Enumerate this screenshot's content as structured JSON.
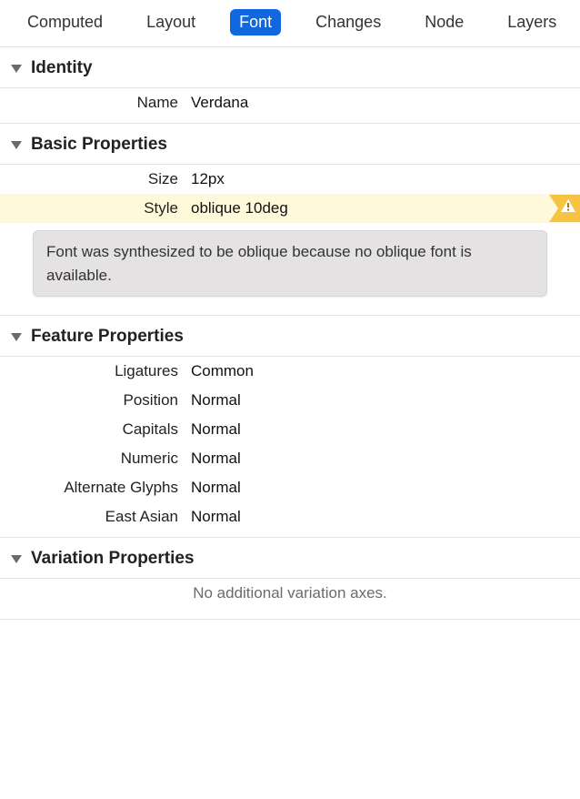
{
  "tabs": {
    "items": [
      {
        "label": "Computed",
        "active": false
      },
      {
        "label": "Layout",
        "active": false
      },
      {
        "label": "Font",
        "active": true
      },
      {
        "label": "Changes",
        "active": false
      },
      {
        "label": "Node",
        "active": false
      },
      {
        "label": "Layers",
        "active": false
      }
    ]
  },
  "sections": {
    "identity": {
      "title": "Identity",
      "rows": [
        {
          "label": "Name",
          "value": "Verdana"
        }
      ]
    },
    "basic": {
      "title": "Basic Properties",
      "rows": [
        {
          "label": "Size",
          "value": "12px"
        },
        {
          "label": "Style",
          "value": "oblique 10deg",
          "warning": true
        }
      ],
      "warning_message": "Font was synthesized to be oblique because no oblique font is available."
    },
    "feature": {
      "title": "Feature Properties",
      "rows": [
        {
          "label": "Ligatures",
          "value": "Common"
        },
        {
          "label": "Position",
          "value": "Normal"
        },
        {
          "label": "Capitals",
          "value": "Normal"
        },
        {
          "label": "Numeric",
          "value": "Normal"
        },
        {
          "label": "Alternate Glyphs",
          "value": "Normal"
        },
        {
          "label": "East Asian",
          "value": "Normal"
        }
      ]
    },
    "variation": {
      "title": "Variation Properties",
      "empty_message": "No additional variation axes."
    }
  }
}
